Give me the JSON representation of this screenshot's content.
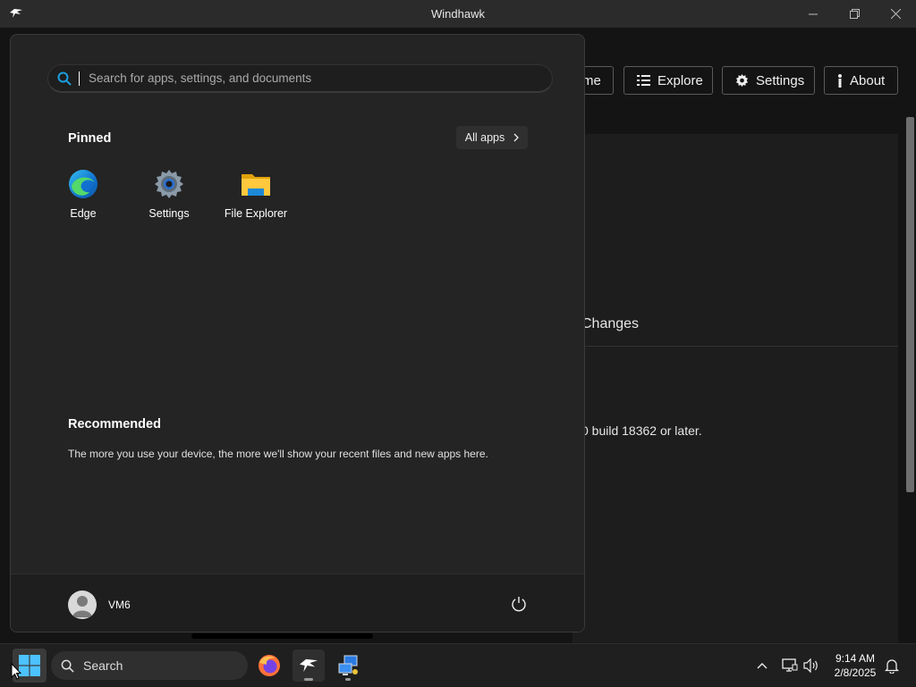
{
  "window": {
    "title": "Windhawk"
  },
  "app": {
    "nav": {
      "home_label": "me",
      "explore_label": "Explore",
      "settings_label": "Settings",
      "about_label": "About"
    },
    "card": {
      "changes_heading": "Changes",
      "requirement_text": "0 build 18362 or later."
    }
  },
  "start_menu": {
    "search": {
      "placeholder": "Search for apps, settings, and documents",
      "value": ""
    },
    "pinned": {
      "title": "Pinned",
      "all_apps_label": "All apps",
      "apps": [
        {
          "label": "Edge",
          "icon": "edge-icon"
        },
        {
          "label": "Settings",
          "icon": "settings-gear-icon"
        },
        {
          "label": "File Explorer",
          "icon": "folder-icon"
        }
      ]
    },
    "recommended": {
      "title": "Recommended",
      "message": "The more you use your device, the more we'll show your recent files and new apps here."
    },
    "user": {
      "name": "VM6"
    }
  },
  "taskbar": {
    "search_label": "Search",
    "apps": [
      "firefox-icon",
      "windhawk-icon",
      "network-tool-icon"
    ],
    "clock": {
      "time": "9:14 AM",
      "date": "2/8/2025"
    }
  },
  "colors": {
    "accent": "#0078d4",
    "start_bg": "#242424",
    "taskbar_bg": "#1f1f1f"
  }
}
